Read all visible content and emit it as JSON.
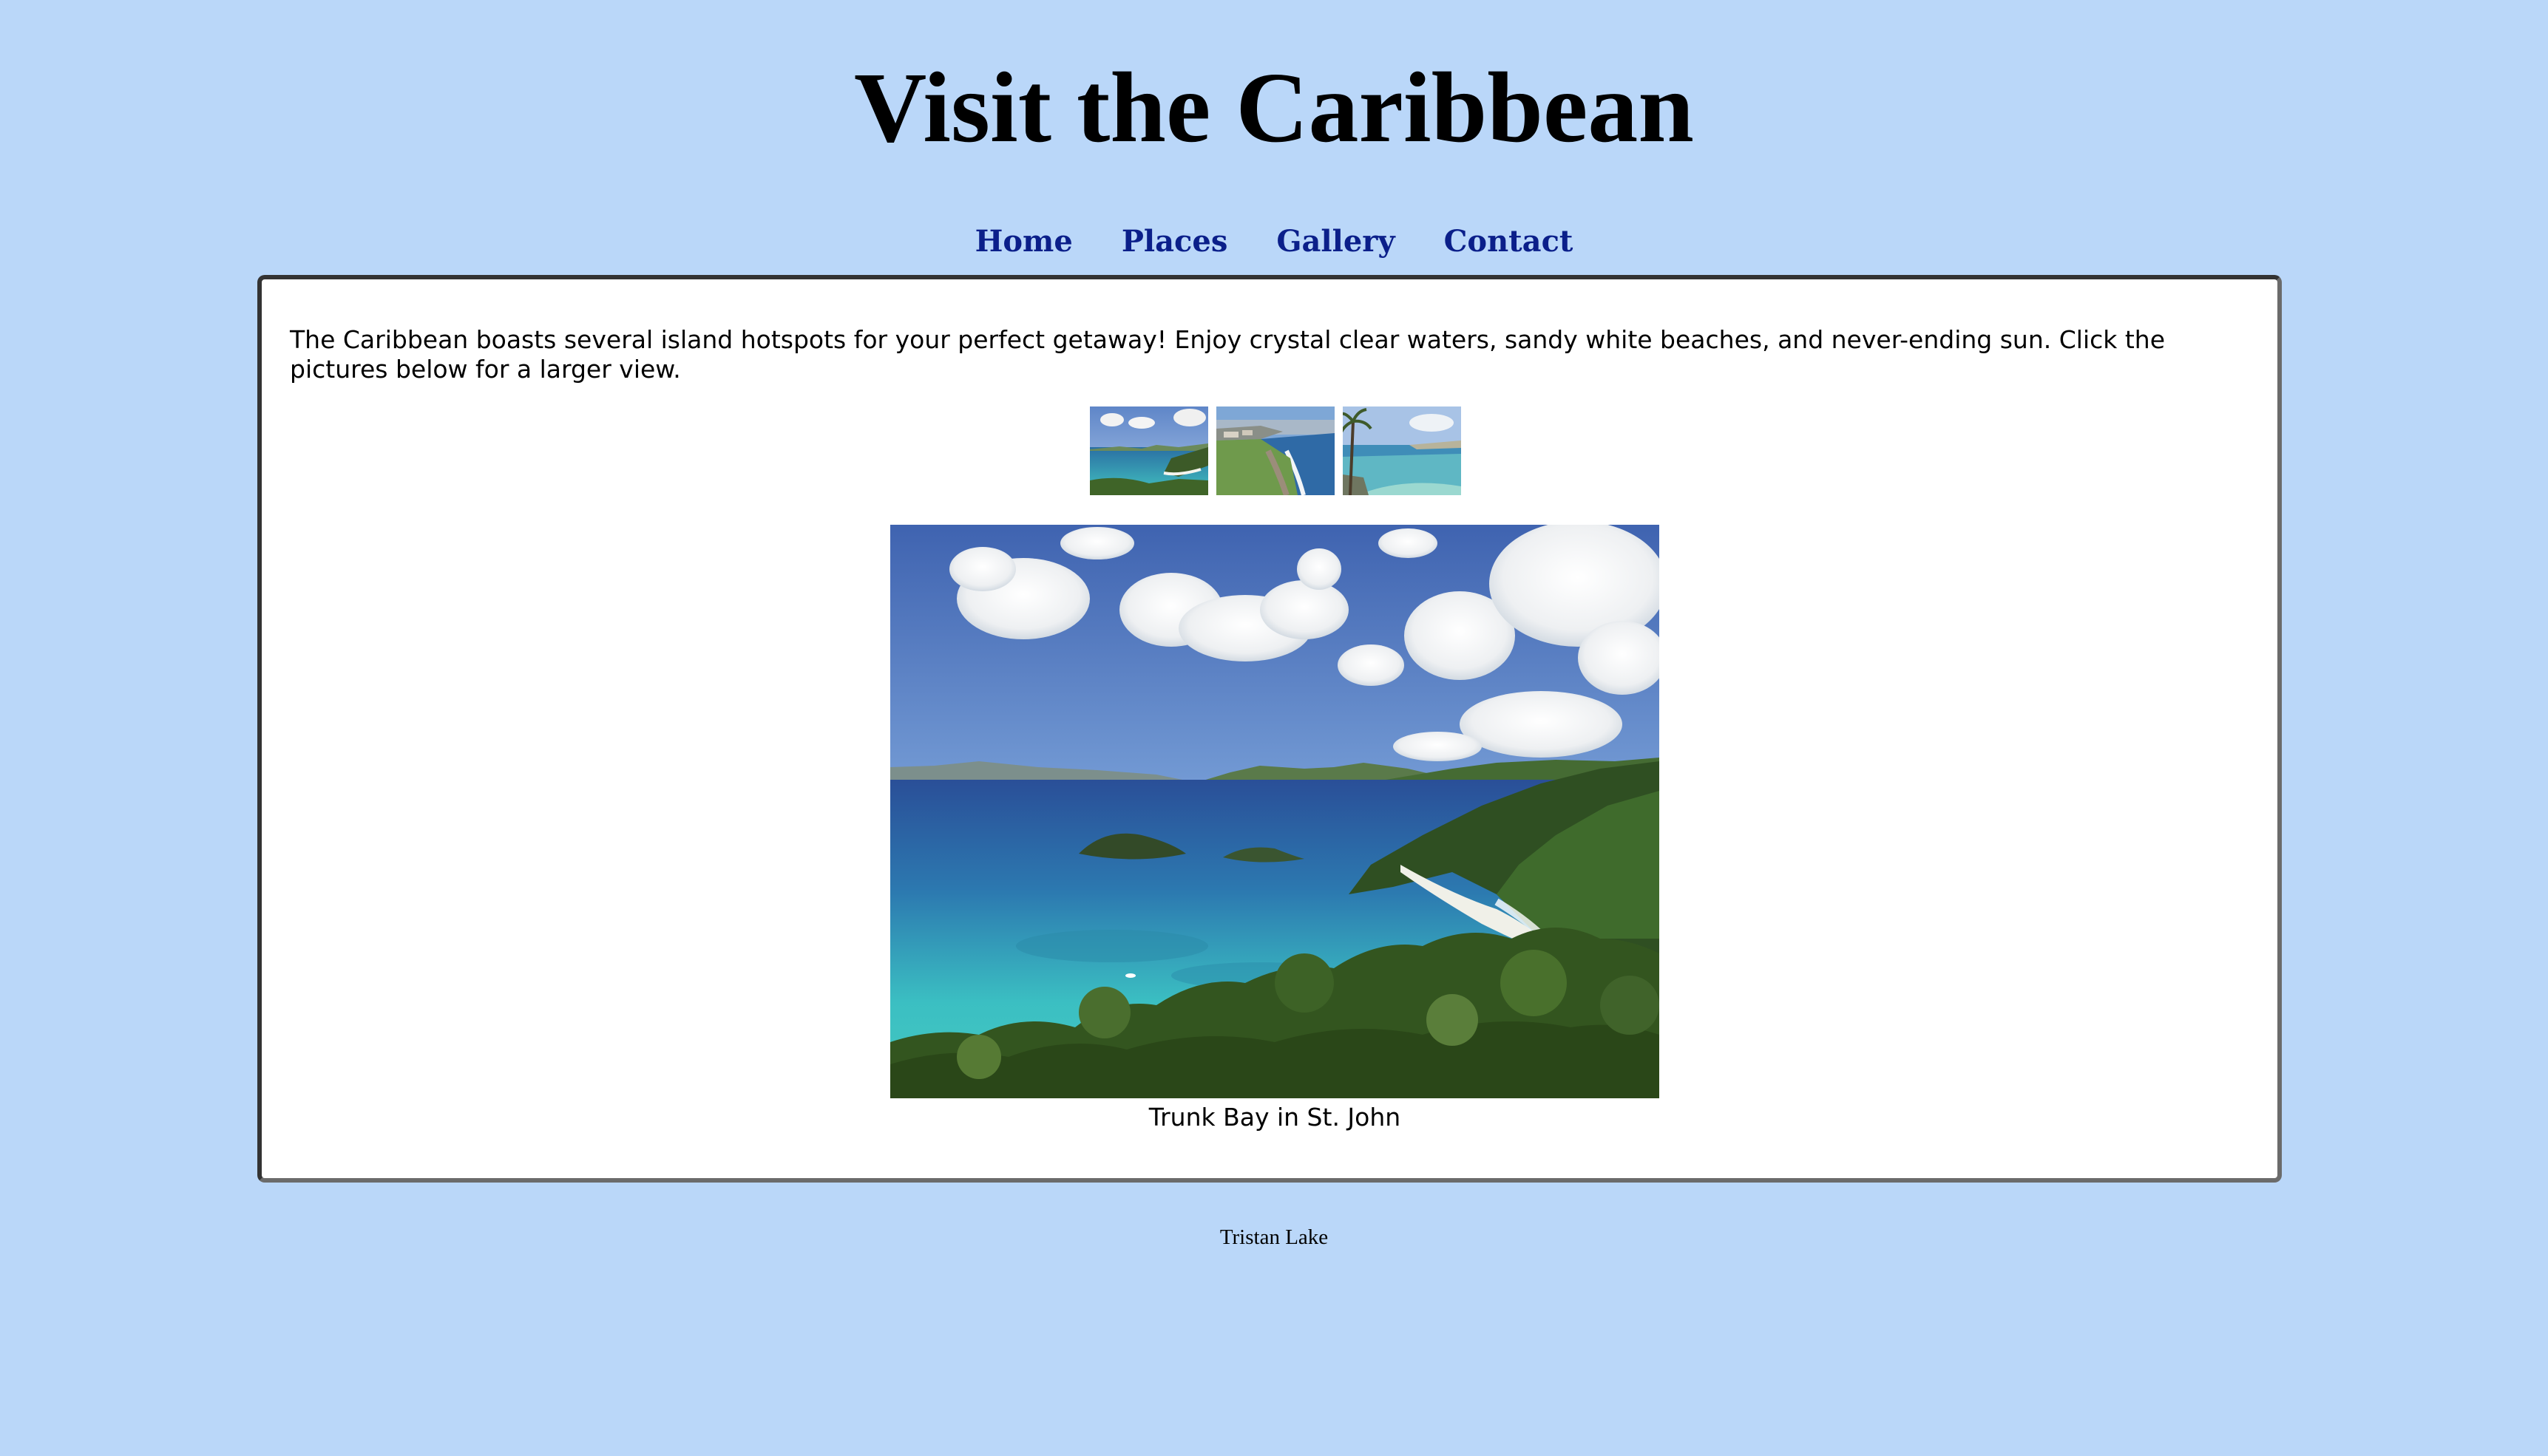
{
  "header": {
    "title": "Visit the Caribbean"
  },
  "nav": {
    "items": [
      {
        "label": "Home"
      },
      {
        "label": "Places"
      },
      {
        "label": "Gallery"
      },
      {
        "label": "Contact"
      }
    ]
  },
  "main": {
    "intro": "The Caribbean boasts several island hotspots for your perfect getaway! Enjoy crystal clear waters, sandy white beaches, and never-ending sun. Click the pictures below for a larger view.",
    "thumbnails": [
      "beach-bay-thumbnail",
      "coastline-thumbnail",
      "palm-beach-thumbnail"
    ],
    "caption": "Trunk Bay in St. John"
  },
  "footer": {
    "author": "Tristan Lake"
  },
  "colors": {
    "page_background": "#bad7f9",
    "nav_link": "#0b1f8a",
    "content_background": "#ffffff"
  }
}
